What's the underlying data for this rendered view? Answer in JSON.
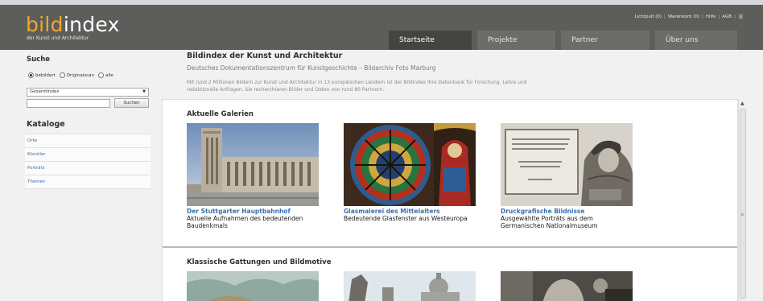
{
  "header": {
    "logo_main": "index",
    "logo_accent": "bild",
    "logo_sub": "der Kunst und Architektur",
    "util_links": [
      "Lichtpult (0)",
      "Warenkorb (0)",
      "Hilfe",
      "AGB"
    ],
    "util_icon": "trophy-icon",
    "tabs": [
      {
        "label": "Startseite",
        "active": true
      },
      {
        "label": "Projekte",
        "active": false
      },
      {
        "label": "Partner",
        "active": false
      },
      {
        "label": "Über uns",
        "active": false
      }
    ]
  },
  "sidebar": {
    "search_heading": "Suche",
    "radio_options": [
      {
        "label": "bebildert",
        "checked": true
      },
      {
        "label": "Originalscan",
        "checked": false
      },
      {
        "label": "alle",
        "checked": false
      }
    ],
    "select_value": "Gesamtindex",
    "search_placeholder": "",
    "search_button": "Suchen",
    "catalog_heading": "Kataloge",
    "catalog_items": [
      "Orte",
      "Künstler",
      "Porträts",
      "Themen"
    ]
  },
  "main": {
    "title": "Bildindex der Kunst und Architektur",
    "subtitle": "Deutsches Dokumentationszentrum für Kunstgeschichte – Bildarchiv Foto Marburg",
    "intro": "Mit rund 2 Millionen Bildern zur Kunst und Architektur in 13 europäischen Ländern ist der Bildindex Ihre Datenbank für Forschung, Lehre und redaktionelle Anfragen. Sie recherchieren Bilder und Daten von rund 80 Partnern.",
    "galleries_heading": "Aktuelle Galerien",
    "galleries": [
      {
        "title": "Der Stuttgarter Hauptbahnhof",
        "desc": "Aktuelle Aufnahmen des bedeutenden Baudenkmals"
      },
      {
        "title": "Glasmalerei des Mittelalters",
        "desc": "Bedeutende Glasfenster aus Westeuropa"
      },
      {
        "title": "Druckgrafische Bildnisse",
        "desc": "Ausgewählte Porträts aus dem Germanischen Nationalmuseum"
      }
    ],
    "classic_heading": "Klassische Gattungen und Bildmotive"
  },
  "colors": {
    "header_bg": "#5d5d5b",
    "logo_accent": "#f0a830",
    "link": "#3a6fb0",
    "active_tab": "#444442"
  }
}
